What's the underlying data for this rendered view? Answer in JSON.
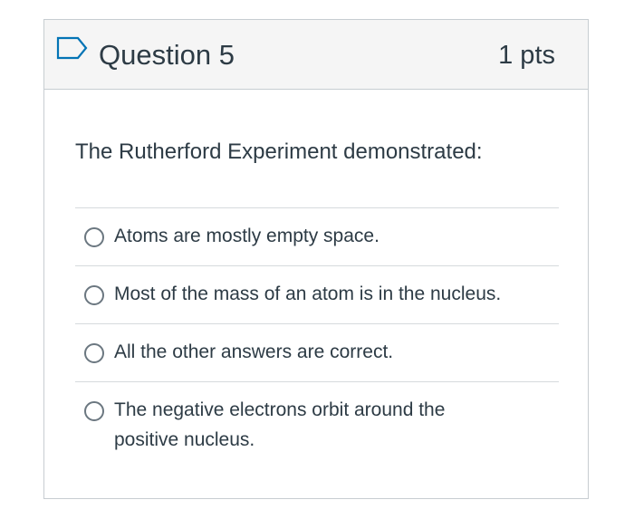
{
  "question": {
    "title": "Question 5",
    "points": "1 pts",
    "text": "The Rutherford Experiment demonstrated:",
    "flag_icon": "bookmark-flag-icon"
  },
  "answers": [
    {
      "label": "Atoms are mostly empty space.",
      "selected": false
    },
    {
      "label": "Most of the mass of an atom is in the nucleus.",
      "selected": false
    },
    {
      "label": "All the other answers are correct.",
      "selected": false
    },
    {
      "label": "The negative electrons orbit around the positive nucleus.",
      "selected": false
    }
  ],
  "colors": {
    "header_bg": "#f5f5f5",
    "border": "#c7cdd1",
    "text": "#2d3b45",
    "flag": "#0374b5"
  }
}
